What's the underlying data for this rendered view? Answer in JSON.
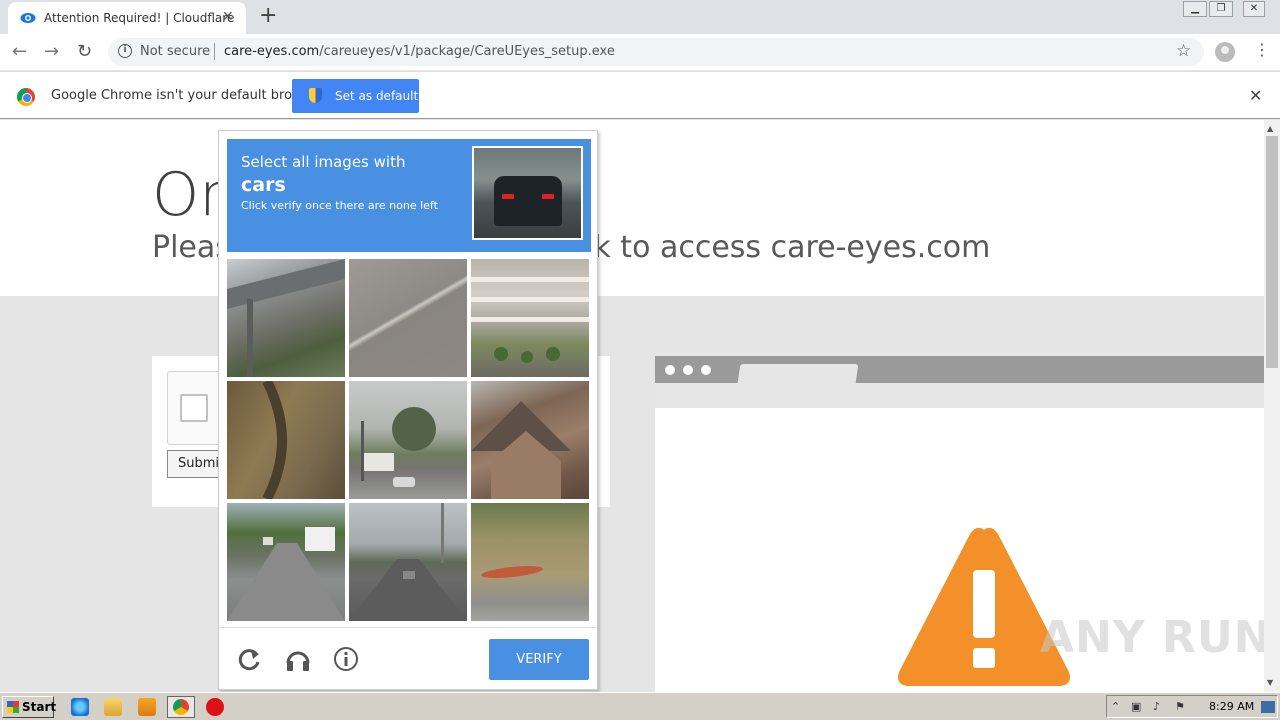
{
  "browser": {
    "tab_title": "Attention Required! | Cloudflare",
    "tab_close": "✕",
    "new_tab": "+",
    "address": {
      "security_label": "Not secure",
      "host": "care-eyes.com",
      "path": "/careueyes/v1/package/CareUEyes_setup.exe"
    }
  },
  "infobar": {
    "message": "Google Chrome isn't your default browser",
    "button_label": "Set as default",
    "close": "✕"
  },
  "page": {
    "title_partial": "On",
    "subtitle_left": "Pleas",
    "subtitle_right": "ck to access care-eyes.com",
    "submit_label": "Submit"
  },
  "captcha": {
    "instruction_line1": "Select all images with",
    "target_word": "cars",
    "instruction_line2": "Click verify once there are none left",
    "verify_label": "VERIFY",
    "tiles": [
      "tile-overpass",
      "tile-road-surface",
      "tile-parking-garage",
      "tile-wall-texture",
      "tile-street-intersection",
      "tile-house-roof",
      "tile-road-truck",
      "tile-highway",
      "tile-grass-kayak"
    ]
  },
  "watermark": "ANY RUN",
  "taskbar": {
    "start_label": "Start",
    "clock": "8:29 AM"
  },
  "colors": {
    "captcha_blue": "#4a90e2",
    "chrome_button_blue": "#4285f4",
    "warning_orange": "#f4902a"
  }
}
